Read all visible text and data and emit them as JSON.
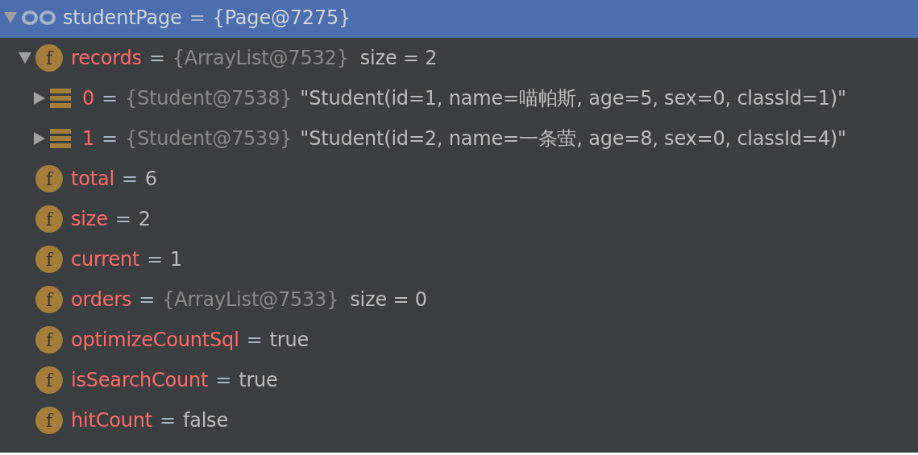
{
  "tree": [
    {
      "kind": "watch",
      "name": "studentPage",
      "sep": "=",
      "type_ref": "{Page@7275}",
      "expanded": true,
      "selected": true,
      "children": [
        {
          "kind": "field",
          "badge": "f",
          "name": "records",
          "sep": "=",
          "type_ref": "{ArrayList@7532}",
          "extra": "size = 2",
          "expanded": true,
          "selected": false,
          "children": [
            {
              "kind": "element",
              "name": "0",
              "sep": "=",
              "type_ref": "{Student@7538}",
              "value": "\"Student(id=1, name=喵帕斯, age=5, sex=0, classId=1)\"",
              "expanded": false,
              "selected": false
            },
            {
              "kind": "element",
              "name": "1",
              "sep": "=",
              "type_ref": "{Student@7539}",
              "value": "\"Student(id=2, name=一条萤, age=8, sex=0, classId=4)\"",
              "expanded": false,
              "selected": false
            }
          ]
        },
        {
          "kind": "field",
          "badge": "f",
          "name": "total",
          "sep": "=",
          "value": "6",
          "selected": false
        },
        {
          "kind": "field",
          "badge": "f",
          "name": "size",
          "sep": "=",
          "value": "2",
          "selected": false
        },
        {
          "kind": "field",
          "badge": "f",
          "name": "current",
          "sep": "=",
          "value": "1",
          "selected": false
        },
        {
          "kind": "field",
          "badge": "f",
          "name": "orders",
          "sep": "=",
          "type_ref": "{ArrayList@7533}",
          "extra": "size = 0",
          "selected": false
        },
        {
          "kind": "field",
          "badge": "f",
          "name": "optimizeCountSql",
          "sep": "=",
          "value": "true",
          "selected": false
        },
        {
          "kind": "field",
          "badge": "f",
          "name": "isSearchCount",
          "sep": "=",
          "value": "true",
          "selected": false
        },
        {
          "kind": "field",
          "badge": "f",
          "name": "hitCount",
          "sep": "=",
          "value": "false",
          "selected": false
        }
      ]
    }
  ]
}
